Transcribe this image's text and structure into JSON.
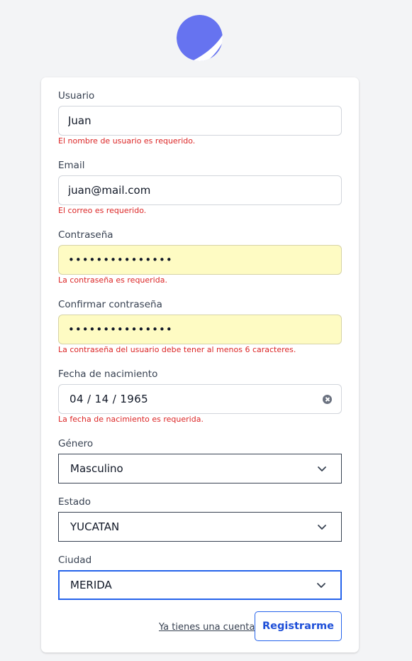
{
  "brand": {
    "logo_icon": "crescent-logo-icon",
    "color": "#6673f0"
  },
  "form": {
    "usuario": {
      "label": "Usuario",
      "value": "Juan",
      "error": "El nombre de usuario es requerido."
    },
    "email": {
      "label": "Email",
      "value": "juan@mail.com",
      "error": "El correo es requerido."
    },
    "password": {
      "label": "Contraseña",
      "masked_value": "•••••••••••••••",
      "error": "La contraseña es requerida."
    },
    "confirm_password": {
      "label": "Confirmar contraseña",
      "masked_value": "•••••••••••••••",
      "error": "La contraseña del usuario debe tener al menos 6 caracteres."
    },
    "birthdate": {
      "label": "Fecha de nacimiento",
      "value": "04 / 14 / 1965",
      "error": "La fecha de nacimiento es requerida."
    },
    "gender": {
      "label": "Género",
      "selected": "Masculino"
    },
    "state": {
      "label": "Estado",
      "selected": "YUCATAN"
    },
    "city": {
      "label": "Ciudad",
      "selected": "MERIDA"
    }
  },
  "actions": {
    "login_link": "Ya tienes una cuenta?",
    "register_button": "Registrarme"
  },
  "colors": {
    "error": "#dc2626",
    "autofill": "#fefbc3",
    "accent": "#2563eb"
  }
}
